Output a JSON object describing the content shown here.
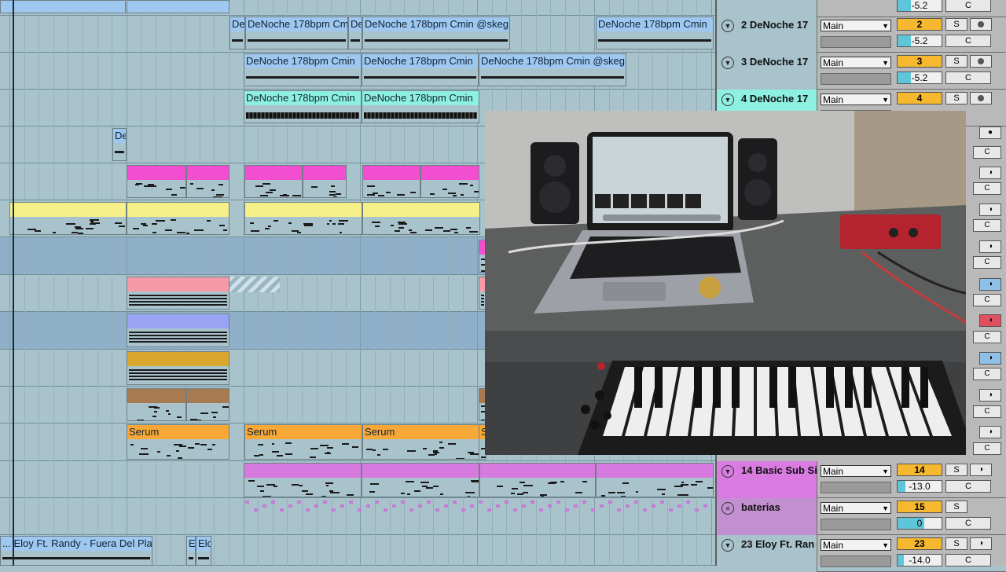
{
  "arrangement": {
    "clips": [
      {
        "label": "De",
        "color": "#9ec8f0"
      },
      {
        "label": "DeNoche 178bpm Cmi",
        "color": "#9ec8f0"
      },
      {
        "label": "De",
        "color": "#9ec8f0"
      },
      {
        "label": "DeNoche 178bpm Cmin @skeg",
        "color": "#9ec8f0"
      },
      {
        "label": "DeNoche 178bpm Cmin",
        "color": "#9ec8f0"
      },
      {
        "label": "DeNoche 178bpm Cmin",
        "color": "#9ec8f0"
      },
      {
        "label": "DeNoche 178bpm Cmin",
        "color": "#9ec8f0"
      },
      {
        "label": "DeNoche 178bpm Cmin @skeg",
        "color": "#9ec8f0"
      },
      {
        "label": "DeNoche 178bpm Cmin",
        "color": "#8ef0e0"
      },
      {
        "label": "DeNoche 178bpm Cmin",
        "color": "#8ef0e0"
      },
      {
        "label": "De",
        "color": "#9ec8f0"
      },
      {
        "label": "Serum",
        "color": "#f7a836"
      },
      {
        "label": "Serum",
        "color": "#f7a836"
      },
      {
        "label": "Serum",
        "color": "#f7a836"
      },
      {
        "label": "S",
        "color": "#f7a836"
      },
      {
        "label": "... Eloy Ft. Randy - Fuera Del Pla",
        "color": "#9ec8f0"
      },
      {
        "label": "E",
        "color": "#9ec8f0"
      },
      {
        "label": "Elo",
        "color": "#9ec8f0"
      }
    ]
  },
  "mixer": {
    "tracks": [
      {
        "name": "",
        "route": "",
        "number": "",
        "volume": "-5.2",
        "solo": "",
        "center": "C",
        "color": "#a9c3cc"
      },
      {
        "name": "2 DeNoche 17",
        "route": "Main",
        "number": "2",
        "volume": "-5.2",
        "solo": "S",
        "center": "C",
        "color": "#a9c3cc"
      },
      {
        "name": "3 DeNoche 17",
        "route": "Main",
        "number": "3",
        "volume": "-5.2",
        "solo": "S",
        "center": "C",
        "color": "#a9c3cc"
      },
      {
        "name": "4 DeNoche 17",
        "route": "Main",
        "number": "4",
        "volume": "",
        "solo": "S",
        "center": "",
        "color": "#8ef0e0"
      },
      {
        "name": "14 Basic Sub Si",
        "route": "Main",
        "number": "14",
        "volume": "-13.0",
        "solo": "S",
        "center": "C",
        "color": "#d97be0"
      },
      {
        "name": "baterias",
        "route": "Main",
        "number": "15",
        "volume": "0",
        "solo": "S",
        "center": "C",
        "color": "#c28fd0"
      },
      {
        "name": "23 Eloy Ft. Ran",
        "route": "Main",
        "number": "23",
        "volume": "-14.0",
        "solo": "S",
        "center": "C",
        "color": "#a9c3cc"
      }
    ],
    "side_center": "C",
    "side_mon_icon": "ear-icon"
  },
  "photo": {
    "caption": ""
  }
}
